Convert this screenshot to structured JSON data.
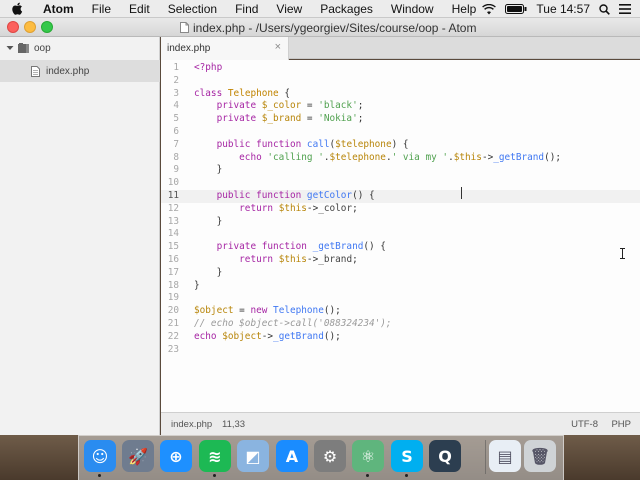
{
  "menubar": {
    "app_name": "Atom",
    "items": [
      "File",
      "Edit",
      "Selection",
      "Find",
      "View",
      "Packages",
      "Window",
      "Help"
    ],
    "clock": "Tue 14:57"
  },
  "window": {
    "title": "index.php - /Users/ygeorgiev/Sites/course/oop - Atom"
  },
  "tree": {
    "root_folder": "oop",
    "files": [
      "index.php"
    ]
  },
  "tabs": [
    {
      "label": "index.php",
      "close_glyph": "×",
      "active": true
    }
  ],
  "editor": {
    "current_line": 11,
    "lines": [
      "<?php",
      "",
      "class Telephone {",
      "    private $_color = 'black';",
      "    private $_brand = 'Nokia';",
      "",
      "    public function call($telephone) {",
      "        echo 'calling '.$telephone.' via my '.$this->_getBrand();",
      "    }",
      "",
      "    public function getColor() {",
      "        return $this->_color;",
      "    }",
      "",
      "    private function _getBrand() {",
      "        return $this->_brand;",
      "    }",
      "}",
      "",
      "$object = new Telephone();",
      "// echo $object->call('088324234');",
      "echo $object->_getBrand();",
      ""
    ]
  },
  "statusbar": {
    "file": "index.php",
    "cursor_position": "11,33",
    "encoding": "UTF-8",
    "grammar": "PHP"
  },
  "dock": {
    "apps": [
      {
        "icon": "finder-icon",
        "color": "#2a8cf0"
      },
      {
        "icon": "launchpad-icon",
        "color": "#6f7c8f"
      },
      {
        "icon": "safari-icon",
        "color": "#1e90ff"
      },
      {
        "icon": "spotify-icon",
        "color": "#1db954"
      },
      {
        "icon": "preview-icon",
        "color": "#8ab4e0"
      },
      {
        "icon": "app-store-icon",
        "color": "#1a8cff"
      },
      {
        "icon": "system-preferences-icon",
        "color": "#7d7d7d"
      },
      {
        "icon": "atom-icon",
        "color": "#5fb57d"
      },
      {
        "icon": "skype-icon",
        "color": "#00aff0"
      },
      {
        "icon": "quicktime-icon",
        "color": "#2c3e50"
      },
      {
        "icon": "archive-file-icon",
        "color": "#e8eef5"
      },
      {
        "icon": "trash-icon",
        "color": "#cfd3d6"
      }
    ]
  }
}
